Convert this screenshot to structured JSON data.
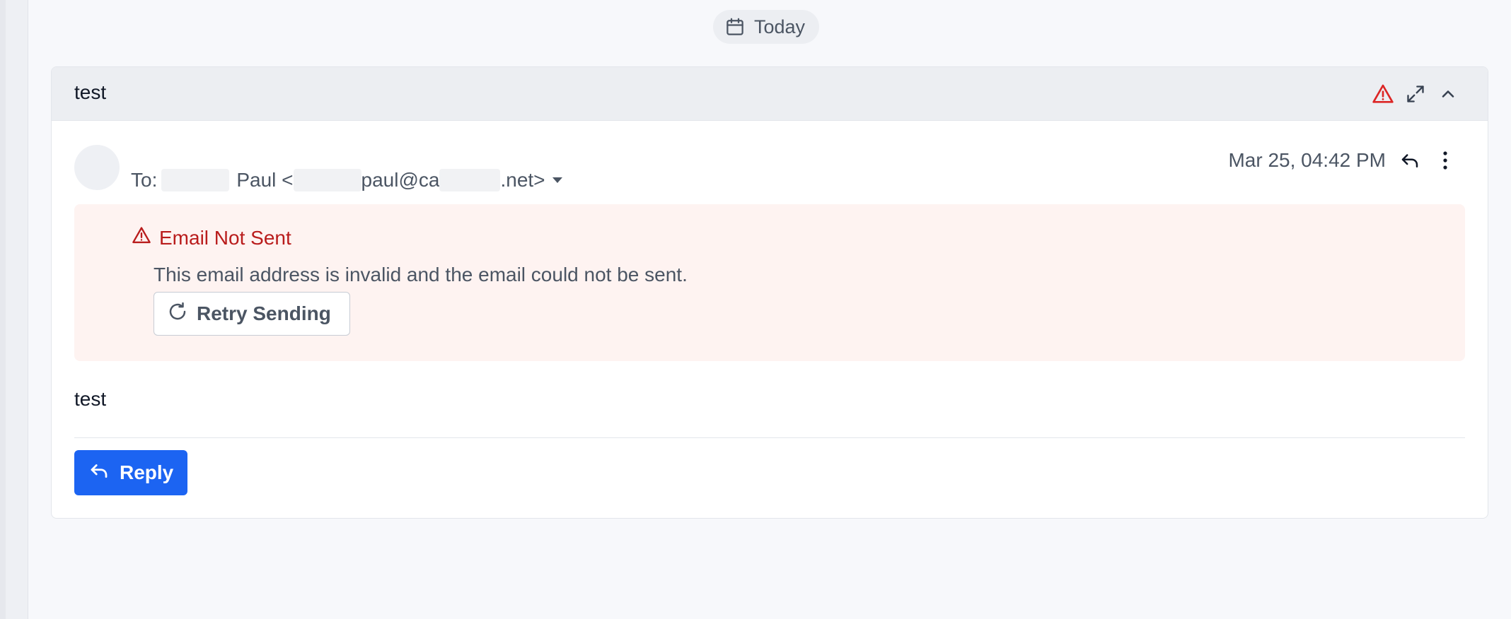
{
  "date_separator": {
    "label": "Today"
  },
  "email": {
    "subject": "test",
    "to_prefix": "To:",
    "recipient_name": "Paul <",
    "recipient_email_part1": "paul@ca",
    "recipient_email_part2": ".net>",
    "date": "Mar 25, 04:42 PM",
    "body": "test"
  },
  "error": {
    "title": "Email Not Sent",
    "message": "This email address is invalid and the email could not be sent.",
    "retry_label": "Retry Sending"
  },
  "actions": {
    "reply_label": "Reply"
  },
  "colors": {
    "accent": "#1c64f2",
    "error": "#b91c1c",
    "error_bg": "#fef3f1",
    "warning_icon": "#dc2626"
  },
  "icons": {
    "date": "calendar-icon",
    "warning": "warning-icon",
    "expand": "expand-icon",
    "collapse": "chevron-up-icon",
    "reply": "reply-icon",
    "more": "more-vertical-icon",
    "retry": "refresh-icon"
  }
}
